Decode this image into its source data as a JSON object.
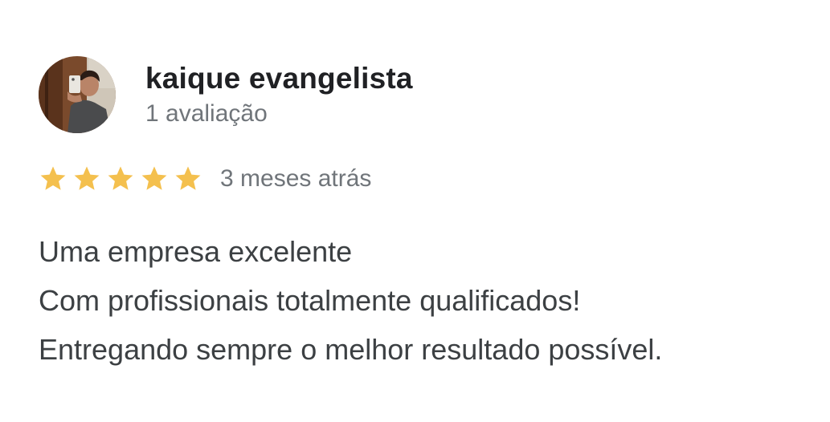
{
  "review": {
    "author": {
      "name": "kaique evangelista",
      "review_count": "1 avaliação",
      "avatar_icon": "user-photo-avatar"
    },
    "rating": 5,
    "rating_max": 5,
    "star_color": "#f4c04e",
    "date": "3 meses atrás",
    "text_lines": [
      "Uma empresa excelente",
      "Com profissionais totalmente qualificados!",
      "Entregando sempre o melhor resultado possível."
    ]
  }
}
